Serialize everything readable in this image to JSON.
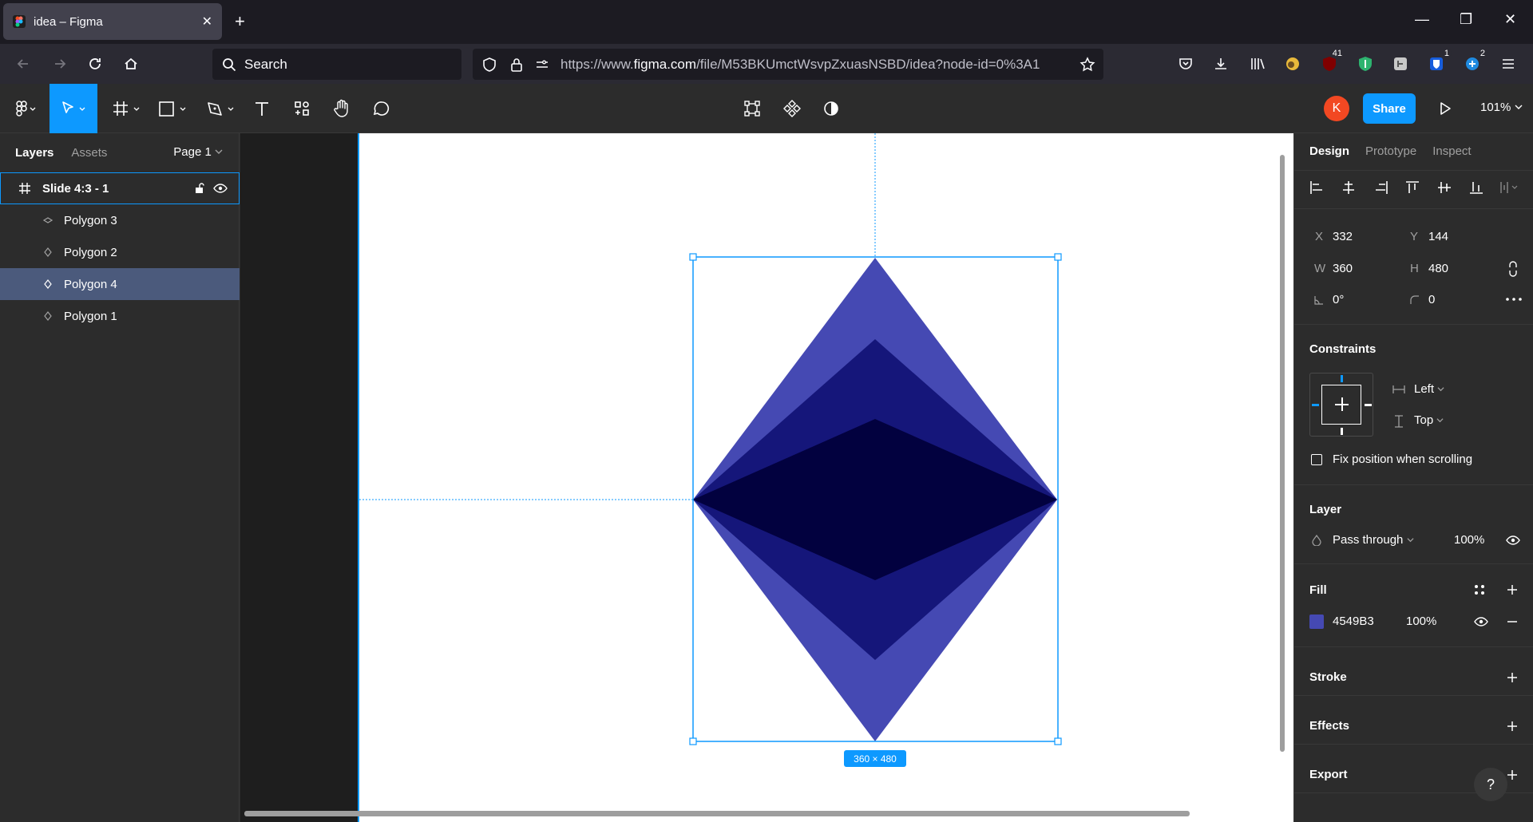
{
  "browser": {
    "tab_title": "idea – Figma",
    "tab_close": "✕",
    "new_tab": "+",
    "search_placeholder": "Search",
    "url_prefix": "https://www.",
    "url_domain": "figma.com",
    "url_path": "/file/M53BKUmctWsvpZxuasNSBD/idea?node-id=0%3A1",
    "badge_ublock": "41",
    "badge_ext1": "1",
    "badge_ext2": "2"
  },
  "toolbar": {
    "share_label": "Share",
    "avatar_initial": "K",
    "zoom": "101%"
  },
  "left_panel": {
    "tabs": [
      "Layers",
      "Assets"
    ],
    "page": "Page 1",
    "frame_name": "Slide 4:3 - 1",
    "layers": [
      "Polygon 3",
      "Polygon 2",
      "Polygon 4",
      "Polygon 1"
    ],
    "selected_layer": "Polygon 4"
  },
  "canvas": {
    "size_label": "360 × 480",
    "colors": {
      "outer": "#4549B3",
      "middle": "#15167A",
      "inner": "#02013F",
      "selection": "#0D99FF"
    }
  },
  "right_panel": {
    "tabs": [
      "Design",
      "Prototype",
      "Inspect"
    ],
    "x_label": "X",
    "x": "332",
    "y_label": "Y",
    "y": "144",
    "w_label": "W",
    "w": "360",
    "h_label": "H",
    "h": "480",
    "rotation": "0°",
    "radius": "0",
    "constraints_title": "Constraints",
    "constraint_h": "Left",
    "constraint_v": "Top",
    "fix_position": "Fix position when scrolling",
    "layer_title": "Layer",
    "blend": "Pass through",
    "layer_opacity": "100%",
    "fill_title": "Fill",
    "fill_hex": "4549B3",
    "fill_opacity": "100%",
    "stroke_title": "Stroke",
    "effects_title": "Effects",
    "export_title": "Export",
    "help": "?"
  }
}
